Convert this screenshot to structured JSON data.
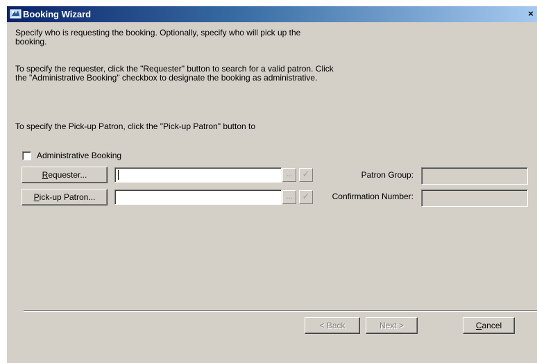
{
  "window": {
    "title": "Booking Wizard",
    "close_glyph": "×"
  },
  "instructions": {
    "p1": "Specify who is requesting the booking.  Optionally, specify who will pick up the booking.",
    "p2": "To specify the requester, click the \"Requester\" button to search for a valid patron.  Click the \"Administrative Booking\" checkbox to designate the booking as administrative.",
    "p3": "To specify the Pick-up Patron, click the \"Pick-up Patron\" button to"
  },
  "admin_checkbox": {
    "label": "Administrative Booking",
    "checked": false
  },
  "requester": {
    "button_label_ul": "R",
    "button_label_rest": "equester...",
    "value": "",
    "browse_glyph": "...",
    "validate_glyph": "✓"
  },
  "pickup": {
    "button_label_ul": "P",
    "button_label_rest": "ick-up Patron...",
    "value": "",
    "browse_glyph": "...",
    "validate_glyph": "✓"
  },
  "patron_group": {
    "label": "Patron Group:",
    "value": ""
  },
  "confirmation": {
    "label": "Confirmation Number:",
    "value": ""
  },
  "footer": {
    "back_label": "< Back",
    "next_label": "Next >",
    "cancel_ul": "C",
    "cancel_rest": "ancel"
  },
  "icons": {
    "title": "booking-wizard-icon"
  }
}
